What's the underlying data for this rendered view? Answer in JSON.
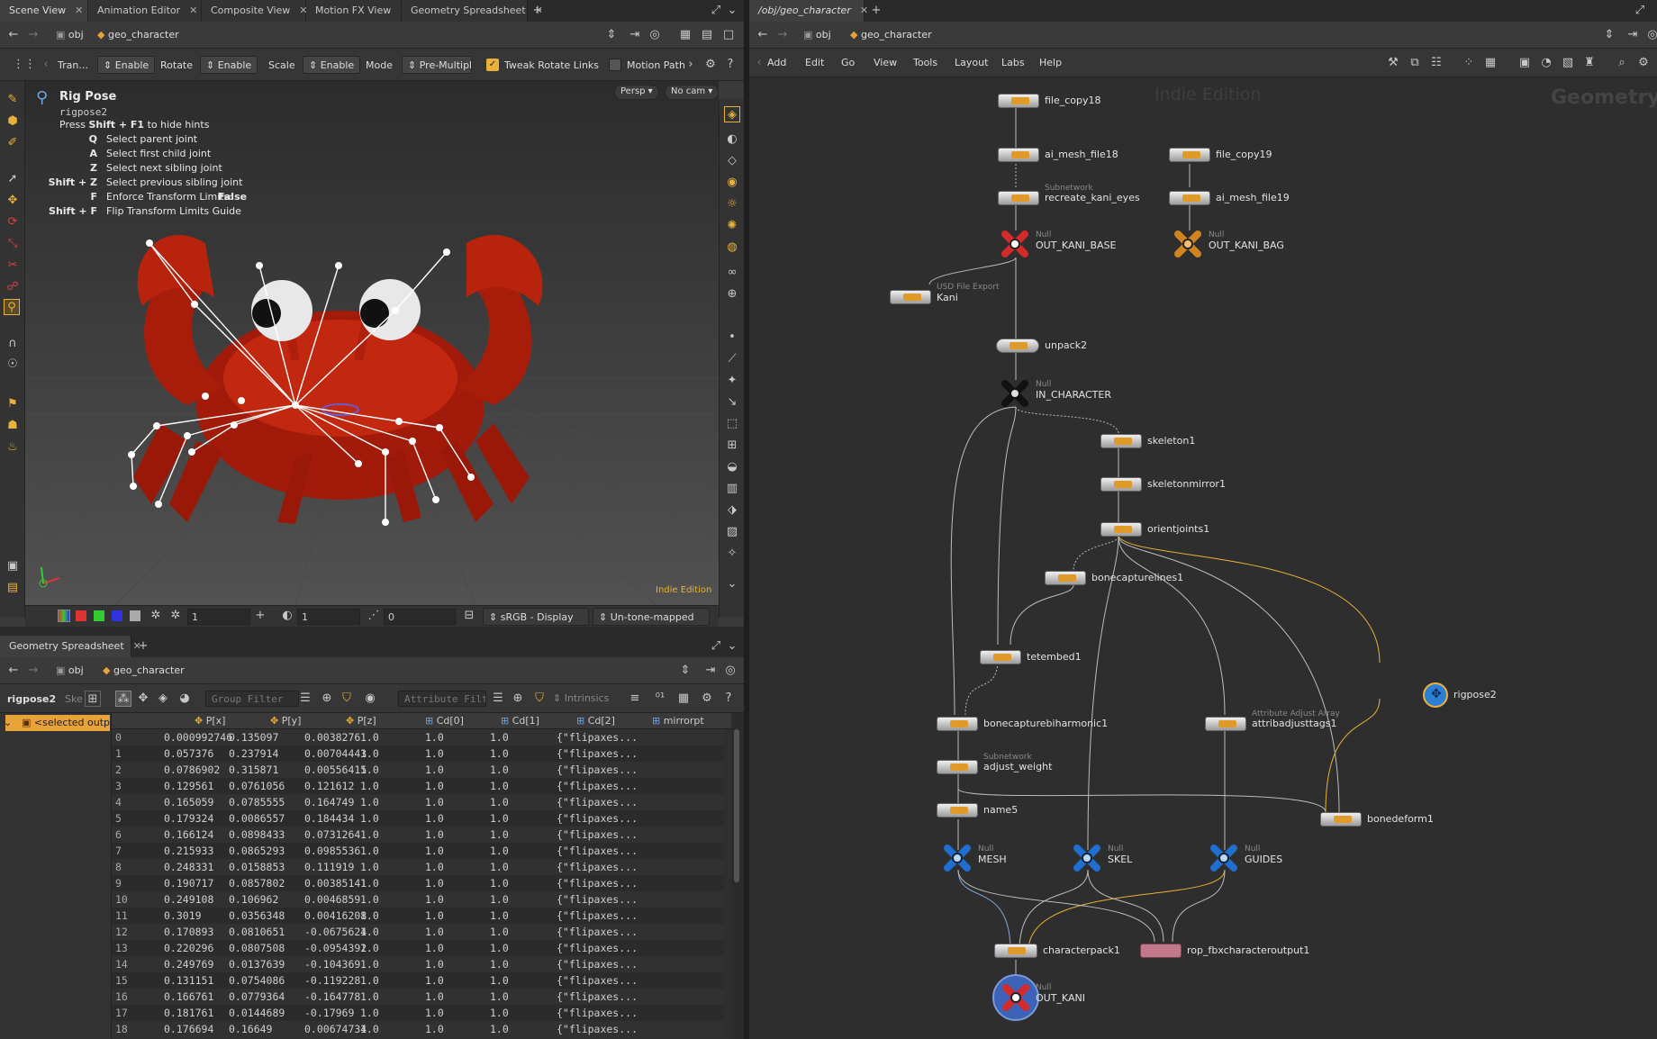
{
  "left_pane": {
    "tabs": [
      {
        "label": "Scene View"
      },
      {
        "label": "Animation Editor"
      },
      {
        "label": "Composite View"
      },
      {
        "label": "Motion FX View"
      },
      {
        "label": "Geometry Spreadsheet"
      }
    ],
    "path": {
      "root": "obj",
      "node": "geo_character"
    },
    "toolbar": {
      "transform": "Tran...",
      "enable1": "Enable",
      "rotate": "Rotate",
      "enable2": "Enable",
      "scale": "Scale",
      "enable3": "Enable",
      "mode": "Mode",
      "premultiply": "Pre-Multiply",
      "tweak_rotate": "Tweak Rotate Links",
      "motion_path": "Motion Path"
    },
    "viewport": {
      "persp": "Persp ▾",
      "cam": "No cam ▾",
      "edition": "Indie Edition",
      "hud": {
        "title": "Rig Pose",
        "node": "rigpose2",
        "hide_hint_pre": "Press ",
        "hide_hint_key": "Shift + F1",
        "hide_hint_post": " to hide hints",
        "hints": [
          {
            "key": "Q",
            "text": "Select parent joint"
          },
          {
            "key": "A",
            "text": "Select first child joint"
          },
          {
            "key": "Z",
            "text": "Select next sibling joint"
          },
          {
            "key": "Shift + Z",
            "text": "Select previous sibling joint"
          },
          {
            "key": "F",
            "text": "Enforce Transform Limits:",
            "value": "False"
          },
          {
            "key": "Shift + F",
            "text": "Flip Transform Limits Guide"
          }
        ]
      }
    },
    "display_bar": {
      "value1": "1",
      "value2": "1",
      "value3": "0",
      "colorspace": "sRGB - Display",
      "tonemap": "Un-tone-mapped"
    }
  },
  "spreadsheet": {
    "tab": "Geometry Spreadsheet",
    "path": {
      "root": "obj",
      "node": "geo_character"
    },
    "node_label": "rigpose2",
    "ske": "Ske",
    "group_filter": "Group Filter",
    "attribute_filter": "Attribute Filter",
    "intrinsics": "Intrinsics",
    "tree_item": "<selected outp",
    "columns": [
      "P[x]",
      "P[y]",
      "P[z]",
      "Cd[0]",
      "Cd[1]",
      "Cd[2]",
      "mirrorpt"
    ],
    "rows": [
      [
        "0",
        "0.000992746",
        "0.135097",
        "0.0038276",
        "1.0",
        "1.0",
        "1.0",
        "{\"flipaxes..."
      ],
      [
        "1",
        "0.057376",
        "0.237914",
        "0.00704443",
        "1.0",
        "1.0",
        "1.0",
        "{\"flipaxes..."
      ],
      [
        "2",
        "0.0786902",
        "0.315871",
        "0.00556415",
        "1.0",
        "1.0",
        "1.0",
        "{\"flipaxes..."
      ],
      [
        "3",
        "0.129561",
        "0.0761056",
        "0.121612",
        "1.0",
        "1.0",
        "1.0",
        "{\"flipaxes..."
      ],
      [
        "4",
        "0.165059",
        "0.0785555",
        "0.164749",
        "1.0",
        "1.0",
        "1.0",
        "{\"flipaxes..."
      ],
      [
        "5",
        "0.179324",
        "0.0086557",
        "0.184434",
        "1.0",
        "1.0",
        "1.0",
        "{\"flipaxes..."
      ],
      [
        "6",
        "0.166124",
        "0.0898433",
        "0.0731264",
        "1.0",
        "1.0",
        "1.0",
        "{\"flipaxes..."
      ],
      [
        "7",
        "0.215933",
        "0.0865293",
        "0.0985536",
        "1.0",
        "1.0",
        "1.0",
        "{\"flipaxes..."
      ],
      [
        "8",
        "0.248331",
        "0.0158853",
        "0.111919",
        "1.0",
        "1.0",
        "1.0",
        "{\"flipaxes..."
      ],
      [
        "9",
        "0.190717",
        "0.0857802",
        "0.00385141",
        "1.0",
        "1.0",
        "1.0",
        "{\"flipaxes..."
      ],
      [
        "10",
        "0.249108",
        "0.106962",
        "0.0046859",
        "1.0",
        "1.0",
        "1.0",
        "{\"flipaxes..."
      ],
      [
        "11",
        "0.3019",
        "0.0356348",
        "0.00416208",
        "1.0",
        "1.0",
        "1.0",
        "{\"flipaxes..."
      ],
      [
        "12",
        "0.170893",
        "0.0810651",
        "-0.0675624",
        "1.0",
        "1.0",
        "1.0",
        "{\"flipaxes..."
      ],
      [
        "13",
        "0.220296",
        "0.0807508",
        "-0.0954392",
        "1.0",
        "1.0",
        "1.0",
        "{\"flipaxes..."
      ],
      [
        "14",
        "0.249769",
        "0.0137639",
        "-0.104369",
        "1.0",
        "1.0",
        "1.0",
        "{\"flipaxes..."
      ],
      [
        "15",
        "0.131151",
        "0.0754086",
        "-0.119228",
        "1.0",
        "1.0",
        "1.0",
        "{\"flipaxes..."
      ],
      [
        "16",
        "0.166761",
        "0.0779364",
        "-0.164778",
        "1.0",
        "1.0",
        "1.0",
        "{\"flipaxes..."
      ],
      [
        "17",
        "0.181761",
        "0.0144689",
        "-0.17969",
        "1.0",
        "1.0",
        "1.0",
        "{\"flipaxes..."
      ],
      [
        "18",
        "0.176694",
        "0.16649",
        "0.00674734",
        "1.0",
        "1.0",
        "1.0",
        "{\"flipaxes..."
      ]
    ]
  },
  "network": {
    "tab": "/obj/geo_character",
    "path": {
      "root": "obj",
      "node": "geo_character"
    },
    "menu": [
      "Add",
      "Edit",
      "Go",
      "View",
      "Tools",
      "Layout",
      "Labs",
      "Help"
    ],
    "watermark_edition": "Indie Edition",
    "watermark_context": "Geometry",
    "nodes": {
      "file_copy18": "file_copy18",
      "ai_mesh_file18": "ai_mesh_file18",
      "recreate_sub": "Subnetwork",
      "recreate_kani_eyes": "recreate_kani_eyes",
      "file_copy19": "file_copy19",
      "ai_mesh_file19": "ai_mesh_file19",
      "out_kani_base_sub": "Null",
      "out_kani_base": "OUT_KANI_BASE",
      "out_kani_bag_sub": "Null",
      "out_kani_bag": "OUT_KANI_BAG",
      "kani_sub": "USD File Export",
      "kani": "Kani",
      "unpack2": "unpack2",
      "in_character_sub": "Null",
      "in_character": "IN_CHARACTER",
      "skeleton1": "skeleton1",
      "skeletonmirror1": "skeletonmirror1",
      "orientjoints1": "orientjoints1",
      "bonecapturelines1": "bonecapturelines1",
      "tetembed1": "tetembed1",
      "rigpose2": "rigpose2",
      "bonecapturebiharmonic1": "bonecapturebiharmonic1",
      "attribadjusttags1_sub": "Attribute Adjust Array",
      "attribadjusttags1": "attribadjusttags1",
      "adjust_weight_sub": "Subnetwork",
      "adjust_weight": "adjust_weight",
      "name5": "name5",
      "bonedeform1": "bonedeform1",
      "mesh_sub": "Null",
      "mesh": "MESH",
      "skel_sub": "Null",
      "skel": "SKEL",
      "guides_sub": "Null",
      "guides": "GUIDES",
      "characterpack1": "characterpack1",
      "rop": "rop_fbxcharacteroutput1",
      "out_kani_sub": "Null",
      "out_kani": "OUT_KANI"
    }
  },
  "colors": {
    "accent": "#e8b13a",
    "null_red": "#d42a2a",
    "null_blue": "#1f6fd1",
    "rigpose": "#2d7fd6",
    "crab": "#b8200c",
    "rop": "#c07a8c"
  }
}
